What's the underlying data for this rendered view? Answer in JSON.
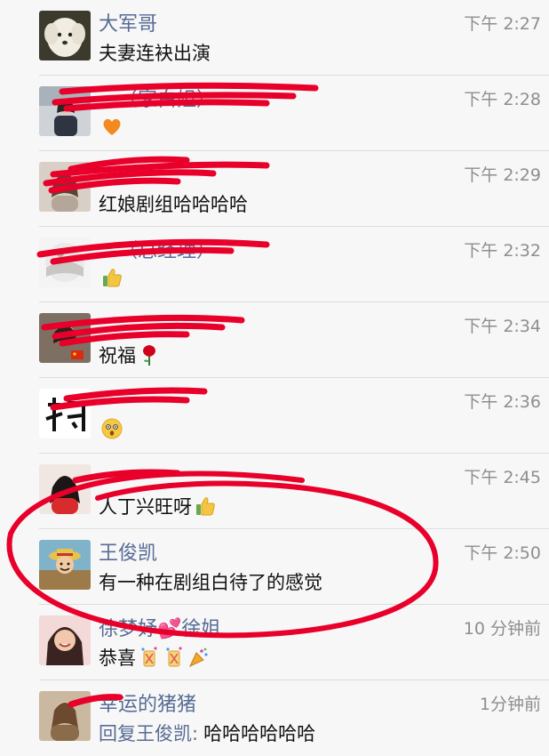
{
  "chats": [
    {
      "name": "大军哥",
      "time": "下午 2:27",
      "message": "夫妻连袂出演",
      "emoji": [],
      "avatar_icon": "white-dog-avatar"
    },
    {
      "name": "…（家白姐）",
      "time": "下午 2:28",
      "message": "",
      "emoji": [
        "orange-heart-emoji"
      ],
      "avatar_icon": "person-avatar"
    },
    {
      "name": "",
      "time": "下午 2:29",
      "message": "红娘剧组哈哈哈哈",
      "emoji": [],
      "avatar_icon": "person-avatar"
    },
    {
      "name": "…（总经理）",
      "time": "下午 2:32",
      "message": "",
      "emoji": [
        "thumbs-up-emoji"
      ],
      "avatar_icon": "person-avatar"
    },
    {
      "name": "",
      "time": "下午 2:34",
      "message": "祝福",
      "emoji": [
        "rose-emoji"
      ],
      "avatar_icon": "person-avatar"
    },
    {
      "name": "",
      "time": "下午 2:36",
      "message": "",
      "emoji": [
        "surprised-face-emoji"
      ],
      "avatar_icon": "calligraphy-avatar"
    },
    {
      "name": "",
      "time": "下午 2:45",
      "message": "人丁兴旺呀",
      "emoji": [
        "thumbs-up-emoji"
      ],
      "avatar_icon": "person-avatar"
    },
    {
      "name": "王俊凯",
      "time": "下午 2:50",
      "message": "有一种在剧组白待了的感觉",
      "emoji": [],
      "avatar_icon": "cartoon-avatar"
    },
    {
      "name": "徐梦妤💕徐姐",
      "time": "10 分钟前",
      "message": "恭喜",
      "emoji": [
        "party-popper-emoji",
        "party-popper-emoji",
        "confetti-emoji"
      ],
      "avatar_icon": "smiling-woman-avatar"
    },
    {
      "name": "幸运的猪猪",
      "time": "1分钟前",
      "message_mention": "回复王俊凯:",
      "message": "哈哈哈哈哈哈",
      "emoji": [],
      "avatar_icon": "person-avatar"
    }
  ],
  "colors": {
    "name": "#576b95",
    "time": "#8e8e8e",
    "scribble": "#e8002a",
    "background": "#f7f7f7"
  }
}
